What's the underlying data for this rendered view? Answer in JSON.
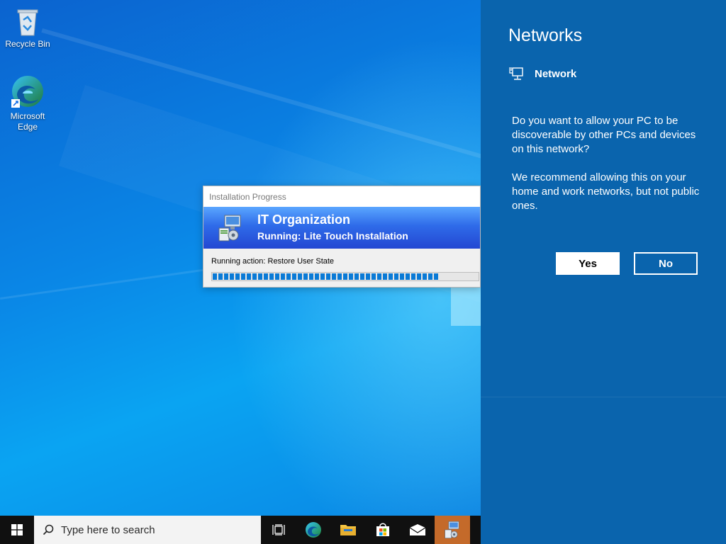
{
  "desktop": {
    "icons": [
      {
        "label": "Recycle Bin",
        "icon": "recycle-bin-icon"
      },
      {
        "label": "Microsoft Edge",
        "icon": "edge-icon"
      }
    ]
  },
  "progress_window": {
    "title": "Installation Progress",
    "organization": "IT Organization",
    "status": "Running: Lite Touch Installation",
    "action": "Running action: Restore User State",
    "progress": 0.85,
    "icon": "deployment-computer-icon"
  },
  "flyout": {
    "heading": "Networks",
    "network_name": "Network",
    "network_icon": "ethernet-icon",
    "question": "Do you want to allow your PC to be discoverable by other PCs and devices on this network?",
    "recommendation": "We recommend allowing this on your home and work networks, but not public ones.",
    "yes_label": "Yes",
    "no_label": "No"
  },
  "taskbar": {
    "search_placeholder": "Type here to search",
    "buttons": [
      {
        "icon": "task-view-icon"
      },
      {
        "icon": "edge-icon"
      },
      {
        "icon": "file-explorer-icon"
      },
      {
        "icon": "microsoft-store-icon"
      },
      {
        "icon": "mail-icon"
      },
      {
        "icon": "deployment-computer-icon",
        "active": true
      }
    ]
  },
  "colors": {
    "flyout_bg": "#0a64ad",
    "taskbar_bg": "#101010",
    "progress_fill": "#0a7ad6",
    "active_task": "#c46a2a"
  }
}
